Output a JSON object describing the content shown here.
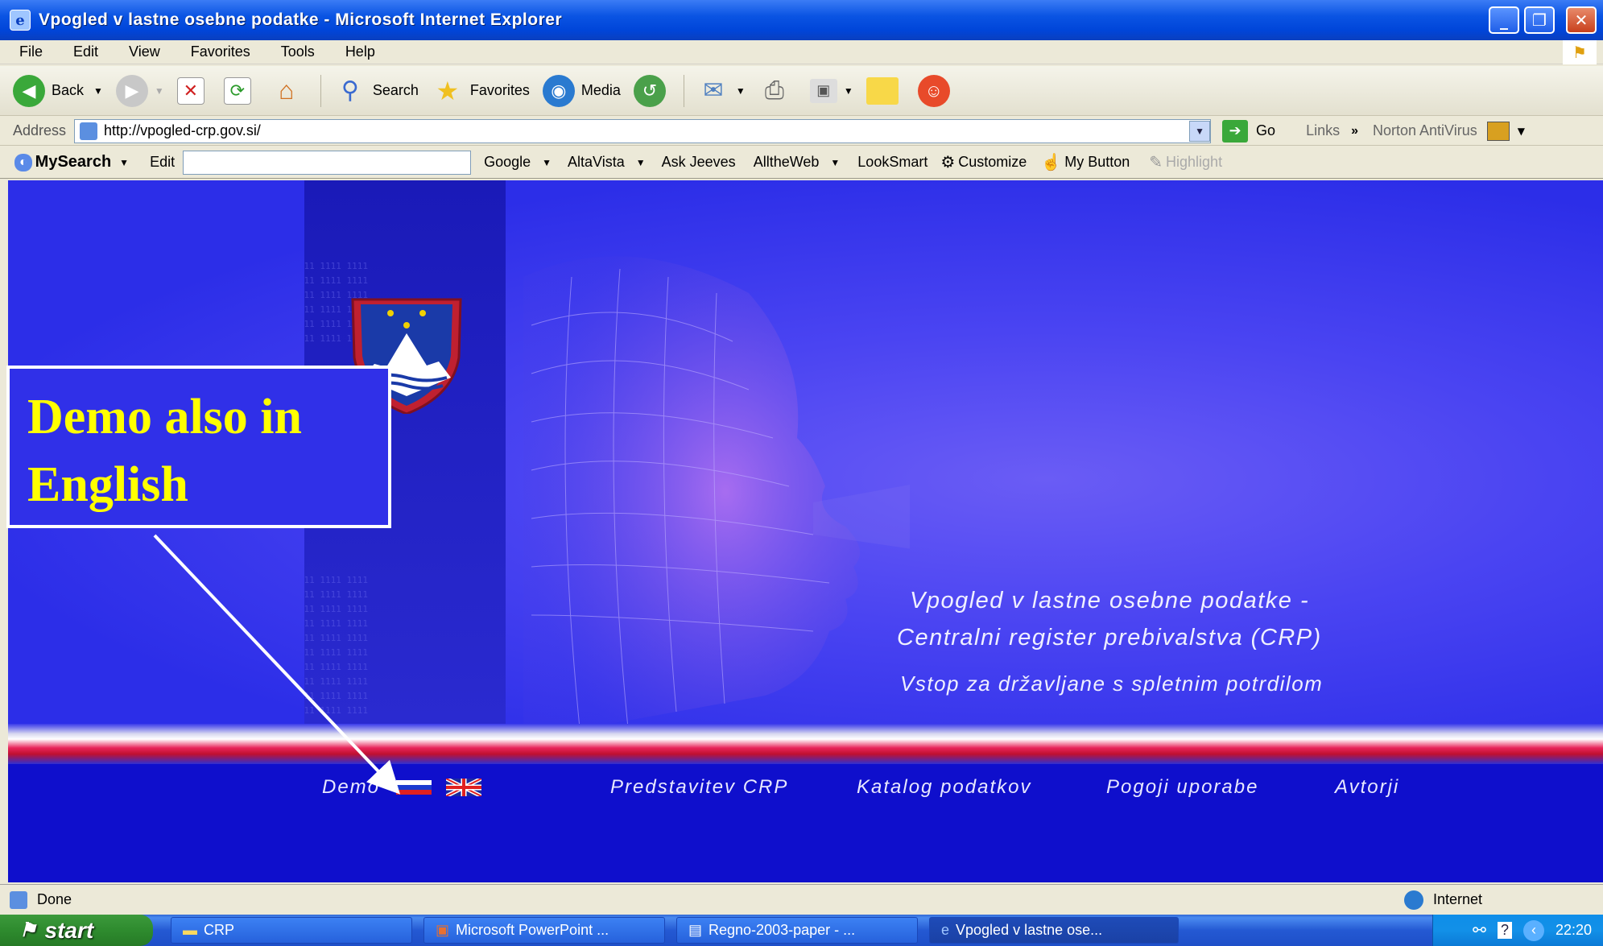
{
  "window": {
    "title": "Vpogled v lastne osebne podatke - Microsoft Internet Explorer",
    "controls": {
      "minimize": "_",
      "restore": "❐",
      "close": "✕"
    }
  },
  "menu": [
    "File",
    "Edit",
    "View",
    "Favorites",
    "Tools",
    "Help"
  ],
  "toolbar": {
    "back": "Back",
    "search": "Search",
    "favorites": "Favorites",
    "media": "Media"
  },
  "address": {
    "label": "Address",
    "url": "http://vpogled-crp.gov.si/",
    "go": "Go",
    "links": "Links",
    "norton": "Norton AntiVirus"
  },
  "searchbar": {
    "brand": "MySearch",
    "edit": "Edit",
    "engines": [
      "Google",
      "AltaVista",
      "Ask Jeeves",
      "AlltheWeb",
      "LookSmart"
    ],
    "customize": "Customize",
    "my_button": "My Button",
    "highlight": "Highlight"
  },
  "page": {
    "heading_line1": "Vpogled v lastne osebne podatke -",
    "heading_line2": "Centralni register prebivalstva (CRP)",
    "subheading": "Vstop za državljane s spletnim potrdilom",
    "demo": "Demo",
    "nav": [
      "Predstavitev CRP",
      "Katalog podatkov",
      "Pogoji uporabe",
      "Avtorji"
    ]
  },
  "callout": {
    "line1": "Demo also in",
    "line2": "English"
  },
  "status": {
    "text": "Done",
    "zone": "Internet"
  },
  "taskbar": {
    "start": "start",
    "tasks": [
      "CRP",
      "Microsoft PowerPoint ...",
      "Regno-2003-paper - ...",
      "Vpogled v lastne ose..."
    ],
    "clock": "22:20"
  }
}
